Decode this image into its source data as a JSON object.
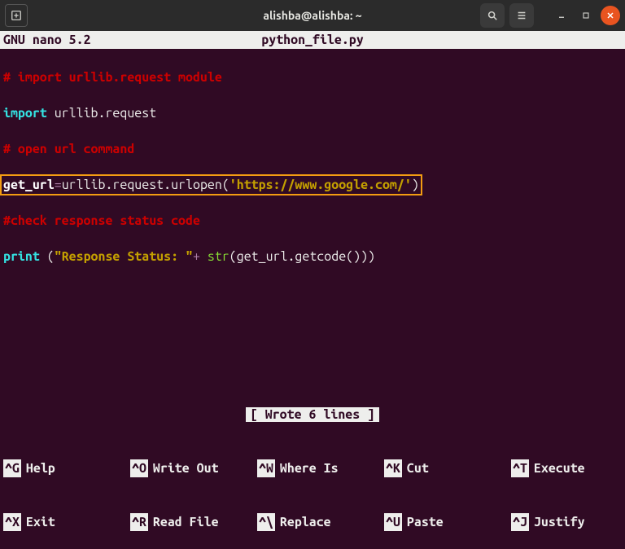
{
  "window": {
    "title": "alishba@alishba: ~"
  },
  "nano": {
    "version": "GNU nano 5.2",
    "filename": "python_file.py",
    "status": "[ Wrote 6 lines ]"
  },
  "code": {
    "l1_comment": "# import urllib.request module",
    "l2_kw": "import",
    "l2_mod": " urllib.request",
    "l3_comment": "# open url command",
    "l4_lhs": "get_url",
    "l4_eq": "=",
    "l4_call": "urllib.request.urlopen(",
    "l4_str": "'https://www.google.com/'",
    "l4_close": ")",
    "l5_comment": "#check response status code",
    "l6_kw": "print",
    "l6_open": " (",
    "l6_str": "\"Response Status: \"",
    "l6_plus": "+ ",
    "l6_str2": "str",
    "l6_rest": "(get_url.getcode()))"
  },
  "shortcuts": {
    "row1": [
      {
        "key": "^G",
        "label": "Help"
      },
      {
        "key": "^O",
        "label": "Write Out"
      },
      {
        "key": "^W",
        "label": "Where Is"
      },
      {
        "key": "^K",
        "label": "Cut"
      },
      {
        "key": "^T",
        "label": "Execute"
      }
    ],
    "row2": [
      {
        "key": "^X",
        "label": "Exit"
      },
      {
        "key": "^R",
        "label": "Read File"
      },
      {
        "key": "^\\",
        "label": "Replace"
      },
      {
        "key": "^U",
        "label": "Paste"
      },
      {
        "key": "^J",
        "label": "Justify"
      }
    ]
  }
}
